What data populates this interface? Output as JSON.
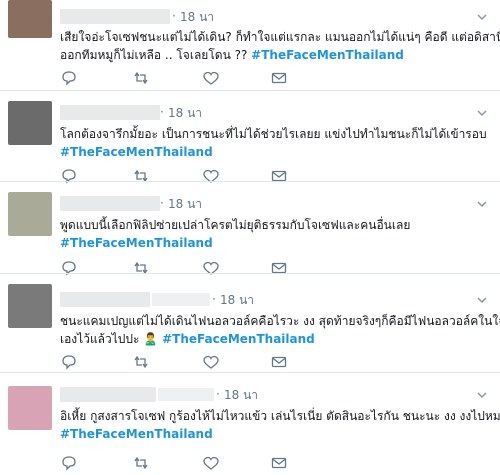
{
  "tweets": [
    {
      "time": "18 นา",
      "lines": [
        "เสียใจอ่ะโจเซฟชนะแต่ไม่ได้เดิน? ก็ทำใจแต่แรกละ แมนออกไม่ได้แน่ๆ คือดี แต่อดิสานี้ถ้า",
        "ออกทีมหมูก็ไม่เหลือ .. โจเลยโดน ??"
      ],
      "hashtag": "#TheFaceMenThailand",
      "avatar_color": "#8a6f60"
    },
    {
      "time": "18 นา",
      "lines": [
        "โลกต้องจารึกมั้ยอะ เป็นการชนะที่ไม่ได้ช่วยไรเลยย แข่งไปทำไมชนะก็ไม่ได้เข้ารอบ"
      ],
      "hashtag": "#TheFaceMenThailand",
      "avatar_color": "#6b6b6b"
    },
    {
      "time": "18 นา",
      "lines": [
        "พูดแบบนี้เลือกฟิลิปซ่ายเปล่าโครตไม่ยุติธรรมกับโจเซฟและคนอื่นเลย"
      ],
      "hashtag": "#TheFaceMenThailand",
      "avatar_color": "#a9ab98"
    },
    {
      "time": "18 นา",
      "lines": [
        "ชนะแคมเปญแต่ไม่ได้เดินไฟนอลวอล์คคือไรวะ งง สุดท้ายจริงๆก็คือมีไฟนอลวอล์คในใจตัว",
        "เองไว้แล้วไปปะ 🙎‍♂️"
      ],
      "hashtag": "#TheFaceMenThailand",
      "avatar_color": "#7a7a7a"
    },
    {
      "time": "18 นา",
      "lines": [
        "อิเหี้ย กูสงสารโจเซฟ กูร้องไห้ไม่ไหวแข้ว เล่นไรเนี่ย ตัดสินอะไรกัน ชนะนะ งง งงไปหมด"
      ],
      "hashtag": "#TheFaceMenThailand",
      "avatar_color": "#d8a3b5"
    }
  ],
  "colors": {
    "hashtag": "#1b95e0",
    "meta": "#657786",
    "icon": "#657786"
  },
  "icons": [
    "reply-icon",
    "retweet-icon",
    "like-icon",
    "direct-message-icon",
    "chevron-down-icon"
  ]
}
